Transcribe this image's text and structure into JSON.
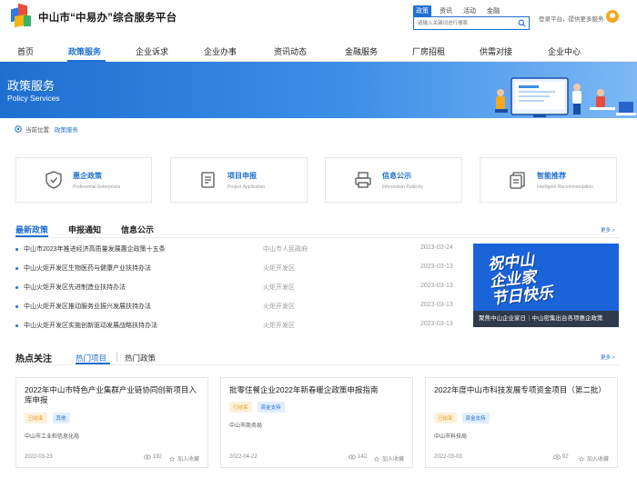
{
  "site": {
    "title": "中山市“中易办”综合服务平台"
  },
  "search": {
    "tabs": [
      "政策",
      "资讯",
      "活动",
      "金融"
    ],
    "placeholder": "请输入关键词进行搜索"
  },
  "login": {
    "text": "登录平台，提供更多服务"
  },
  "nav": {
    "items": [
      "首页",
      "政策服务",
      "企业诉求",
      "企业办事",
      "资讯动态",
      "金融服务",
      "厂房招租",
      "供需对接",
      "企业中心"
    ],
    "active_index": 1
  },
  "banner": {
    "title": "政策服务",
    "subtitle": "Policy Services"
  },
  "breadcrumb": {
    "label": "当前位置:",
    "current": "政策服务"
  },
  "services": [
    {
      "title": "惠企政策",
      "subtitle": "Preferential Enterprises",
      "icon": "shield-icon"
    },
    {
      "title": "项目申报",
      "subtitle": "Project Application",
      "icon": "document-icon"
    },
    {
      "title": "信息公示",
      "subtitle": "Information Publicity",
      "icon": "printer-icon"
    },
    {
      "title": "智能推荐",
      "subtitle": "Intelligent Recommendation",
      "icon": "file-stack-icon"
    }
  ],
  "news": {
    "tabs": [
      "最新政策",
      "申报通知",
      "信息公示"
    ],
    "more": "更多 >",
    "items": [
      {
        "title": "中山市2023年推进经济高质量发展惠企政策十五条",
        "source": "中山市人民政府",
        "date": "2023-03-24"
      },
      {
        "title": "中山火炬开发区生物医药与健康产业扶持办法",
        "source": "火炬开发区",
        "date": "2023-03-13"
      },
      {
        "title": "中山火炬开发区先进制造业扶持办法",
        "source": "火炬开发区",
        "date": "2023-03-13"
      },
      {
        "title": "中山火炬开发区推动服务业振兴发展扶持办法",
        "source": "火炬开发区",
        "date": "2023-03-13"
      },
      {
        "title": "中山火炬开发区实施创新驱动发展战略扶持办法",
        "source": "火炬开发区",
        "date": "2023-03-13"
      }
    ],
    "promo": {
      "text": "祝中山\n企业家\n节日快乐",
      "caption": "聚焦中山企业家日｜中山密集出台各项惠企政策"
    }
  },
  "hot": {
    "title": "热点关注",
    "tabs": [
      "热门项目",
      "热门政策"
    ],
    "more": "更多 >",
    "cards": [
      {
        "title": "2022年中山市特色产业集群产业链协同创新项目入库申报",
        "tags": [
          "已结束",
          "其他"
        ],
        "org": "中山市工业和信息化局",
        "date": "2022-03-23",
        "views": "192",
        "fav": "加入收藏"
      },
      {
        "title": "批零住餐企业2022年新春暖企政策申报指南",
        "tags": [
          "已结束",
          "资金支持"
        ],
        "org": "中山市商务局",
        "date": "2022-04-22",
        "views": "142",
        "fav": "加入收藏"
      },
      {
        "title": "2022年度中山市科技发展专项资金项目（第二批）",
        "tags": [
          "已结束",
          "资金支持"
        ],
        "org": "中山市科技局",
        "date": "2022-03-03",
        "views": "92",
        "fav": "加入收藏"
      }
    ]
  },
  "colors": {
    "accent": "#1f6fd1",
    "tag_orange": "#f0a020"
  }
}
